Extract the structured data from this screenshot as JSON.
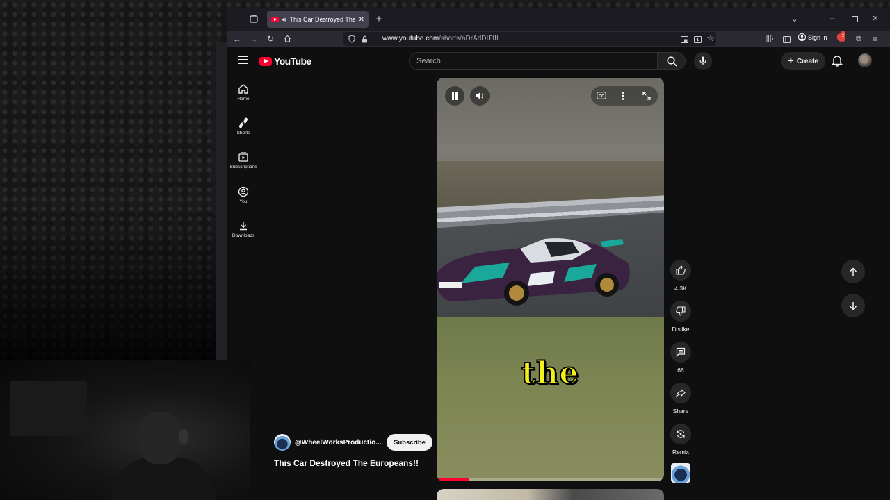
{
  "browser": {
    "tab_title": "This Car Destroyed The Europeans!!",
    "url_host": "www.youtube.com",
    "url_path": "/shorts/aDrAdDIFfII",
    "sign_in_label": "Sign in",
    "extension_badge": "2"
  },
  "youtube": {
    "logo_text": "YouTube",
    "search_placeholder": "Search",
    "create_label": "Create",
    "sidebar": [
      {
        "label": "Home",
        "icon": "home-icon"
      },
      {
        "label": "Shorts",
        "icon": "shorts-icon"
      },
      {
        "label": "Subscriptions",
        "icon": "subscriptions-icon"
      },
      {
        "label": "You",
        "icon": "you-icon"
      },
      {
        "label": "Downloads",
        "icon": "download-icon"
      }
    ],
    "short": {
      "caption_word": "the",
      "progress": 0.14,
      "channel_handle": "@WheelWorksProductio...",
      "subscribe_label": "Subscribe",
      "title": "This Car Destroyed The Europeans!!"
    },
    "actions": {
      "likes": "4.3K",
      "dislike": "Dislike",
      "comments": "66",
      "share": "Share",
      "remix": "Remix"
    }
  },
  "colors": {
    "yt_red": "#ff0033",
    "page_bg": "#0f0f0f",
    "button_bg": "#272727",
    "caption_yellow": "#f3f01c"
  }
}
